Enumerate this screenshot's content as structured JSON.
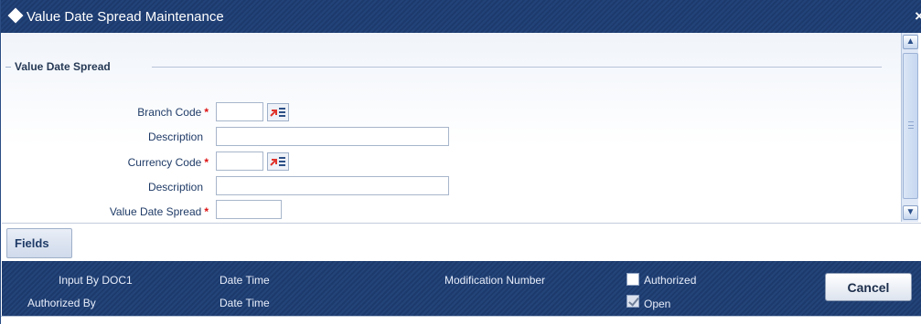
{
  "window": {
    "title": "Value Date Spread Maintenance",
    "close_glyph": "×"
  },
  "section": {
    "title": "Value Date Spread"
  },
  "form": {
    "branch_code": {
      "label": "Branch Code",
      "value": "",
      "required_mark": "*"
    },
    "branch_description": {
      "label": "Description",
      "value": ""
    },
    "currency_code": {
      "label": "Currency Code",
      "value": "",
      "required_mark": "*"
    },
    "currency_description": {
      "label": "Description",
      "value": ""
    },
    "value_date_spread": {
      "label": "Value Date Spread",
      "value": "",
      "required_mark": "*"
    }
  },
  "tabs": {
    "fields_label": "Fields"
  },
  "footer": {
    "input_by": "Input By DOC1",
    "date_time_1": "Date Time",
    "authorized_by": "Authorized By",
    "date_time_2": "Date Time",
    "modification_number": "Modification Number",
    "authorized": {
      "label": "Authorized",
      "checked": false
    },
    "open": {
      "label": "Open",
      "checked": true
    },
    "cancel_label": "Cancel"
  },
  "icons": {
    "lov": "list-of-values-icon",
    "scroll_up": "chevron-up-icon",
    "scroll_down": "chevron-down-icon",
    "close": "close-icon",
    "title_marker": "diamond-icon"
  },
  "colors": {
    "titlebar": "#1d3a6d",
    "required": "#dd1111",
    "label_text": "#1f3b67"
  }
}
